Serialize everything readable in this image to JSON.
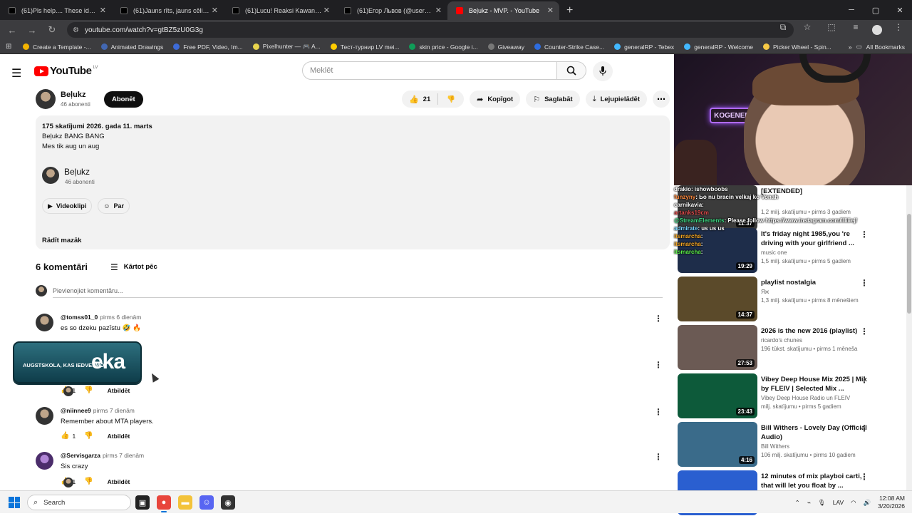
{
  "browser": {
    "tabs": [
      {
        "label": "(61)Pls help.... These ideas made",
        "favicon": "profile-avatar",
        "active": false
      },
      {
        "label": "(61)Jauns rīts, jauns cēliens!@M",
        "favicon": "tiktok-icon",
        "active": false
      },
      {
        "label": "(61)Lucu! Reaksi Kawan Terhada",
        "favicon": "tiktok-icon",
        "active": false
      },
      {
        "label": "(61)Егор Львов (@user668807",
        "favicon": "tiktok-icon",
        "active": false
      },
      {
        "label": "Beļukz - MVP. - YouTube",
        "favicon": "youtube-icon",
        "active": true
      }
    ],
    "url": "youtube.com/watch?v=gtBZ5zU0G3g",
    "bookmarks": [
      {
        "label": "Create a Template -...",
        "color": "#f4b400"
      },
      {
        "label": "Animated Drawings",
        "color": "#4267b2"
      },
      {
        "label": "Free PDF, Video, Im...",
        "color": "#3d6bd8"
      },
      {
        "label": "Pixelhunter — 🎮 A...",
        "color": "#e8d44d"
      },
      {
        "label": "Тест-турнир LV mei...",
        "color": "#ffcc00"
      },
      {
        "label": "skin price - Google i...",
        "color": "#0f9d58"
      },
      {
        "label": "Giveaway",
        "color": "#777777"
      },
      {
        "label": "Counter-Strike Case...",
        "color": "#2d6cdf"
      },
      {
        "label": "generalRP - Tebex",
        "color": "#42b8ff"
      },
      {
        "label": "generalRP - Welcome",
        "color": "#42b8ff"
      },
      {
        "label": "Picker Wheel - Spin...",
        "color": "#f6c945"
      }
    ],
    "all_bookmarks": "All Bookmarks"
  },
  "youtube": {
    "logo": "YouTube",
    "country": "LV",
    "search_placeholder": "Meklēt",
    "channel": {
      "name": "Beļukz",
      "subs": "46 abonenti",
      "subscribe": "Abonēt"
    },
    "actions": {
      "likes": "21",
      "share": "Kopīgot",
      "save": "Saglabāt",
      "download": "Lejupielādēt"
    },
    "description": {
      "stats": "175 skatījumi  2026. gada 11. marts",
      "line1": "Beļukz BANG BANG",
      "line2": "Mes tik aug un aug",
      "channel_name": "Beļukz",
      "channel_subs": "46 abonenti",
      "btn_videos": "Videoklipi",
      "btn_about": "Par",
      "show_less": "Rādīt mazāk"
    },
    "comments": {
      "count": "6 komentāri",
      "sort": "Kārtot pēc",
      "add_placeholder": "Pievienojiet komentāru...",
      "items": [
        {
          "author": "@tomss01_0",
          "time": "pirms 6 dienām",
          "text": "es so dzeku pazīstu 🤣 🔥",
          "likes": "",
          "reply": ""
        },
        {
          "author": "",
          "time": "",
          "text": "",
          "likes": "1",
          "reply": "Atbildēt"
        },
        {
          "author": "@niinnee9",
          "time": "pirms 7 dienām",
          "text": "Remember about MTA players.",
          "likes": "1",
          "reply": "Atbildēt"
        },
        {
          "author": "@Servisgarza",
          "time": "pirms 7 dienām",
          "text": "Sis crazy",
          "likes": "1",
          "reply": "Atbildēt"
        }
      ]
    },
    "ad_overlay": {
      "text": "AUGSTSKOLA, KAS IEDVESMO!",
      "brand": "eka"
    }
  },
  "recommended": [
    {
      "title": "[EXTENDED]",
      "channel": "",
      "meta": "1,2 milj. skatījumu • pirms 3 gadiem",
      "duration": "11:37",
      "thumb": "#3b3b3b"
    },
    {
      "title": "It's friday night 1985,you 're driving with your girlfriend ...",
      "channel": "music one",
      "meta": "1,5 milj. skatījumu • pirms 5 gadiem",
      "duration": "19:29",
      "thumb": "#1e2d4a"
    },
    {
      "title": "playlist nostalgia",
      "channel": "Яж",
      "meta": "1,3 milj. skatījumu • pirms 8 mēnešiem",
      "duration": "14:37",
      "thumb": "#5b4a2a"
    },
    {
      "title": "2026 is the new 2016 (playlist)",
      "channel": "ricardo's chunes",
      "meta": "196 tūkst. skatījumu • pirms 1 mēneša",
      "duration": "27:53",
      "thumb": "#6b5a54"
    },
    {
      "title": "Vibey Deep House Mix 2025 | Mix by FLEIV | Selected Mix ...",
      "channel": "Vibey Deep House Radio un FLEIV",
      "meta": "milj. skatījumu • pirms 5 gadiem",
      "duration": "23:43",
      "thumb": "#0d5a3a"
    },
    {
      "title": "Bill Withers - Lovely Day (Official Audio)",
      "channel": "Bill Withers",
      "meta": "106 milj. skatījumu • pirms 10 gadiem",
      "duration": "4:16",
      "thumb": "#3a6b8a"
    },
    {
      "title": "12 minutes of mix playboi carti, that will let you float by ...",
      "channel": "",
      "meta": "",
      "duration": "",
      "thumb": "#2a5fd0"
    }
  ],
  "stream_chat": [
    {
      "user": "drakio",
      "msg": ": ishowboobs",
      "cls": "u1"
    },
    {
      "user": "funzyny",
      "msg": ": Ьo nu bracin velkaj ko Vonah",
      "cls": "u2"
    },
    {
      "user": "carnikavia",
      "msg": ": ",
      "cls": "u1"
    },
    {
      "user": "artanks19cm",
      "msg": "",
      "cls": "u3"
    },
    {
      "user": "@StreamElements",
      "msg": ": Please follow https://www.instagram.com/illiiiej/",
      "cls": "u4"
    },
    {
      "user": "admirate",
      "msg": ": us us us",
      "cls": "u5"
    },
    {
      "user": "itsmarcha",
      "msg": ": ",
      "cls": "u6"
    },
    {
      "user": "itsmarcha",
      "msg": ": ",
      "cls": "u6"
    },
    {
      "user": "itsmarcha",
      "msg": ":",
      "cls": "u7"
    }
  ],
  "webcam_sign": "KOGENERA",
  "taskbar": {
    "search": "Search",
    "lang": "LAV",
    "time": "12:08 AM",
    "date": "3/20/2026"
  }
}
